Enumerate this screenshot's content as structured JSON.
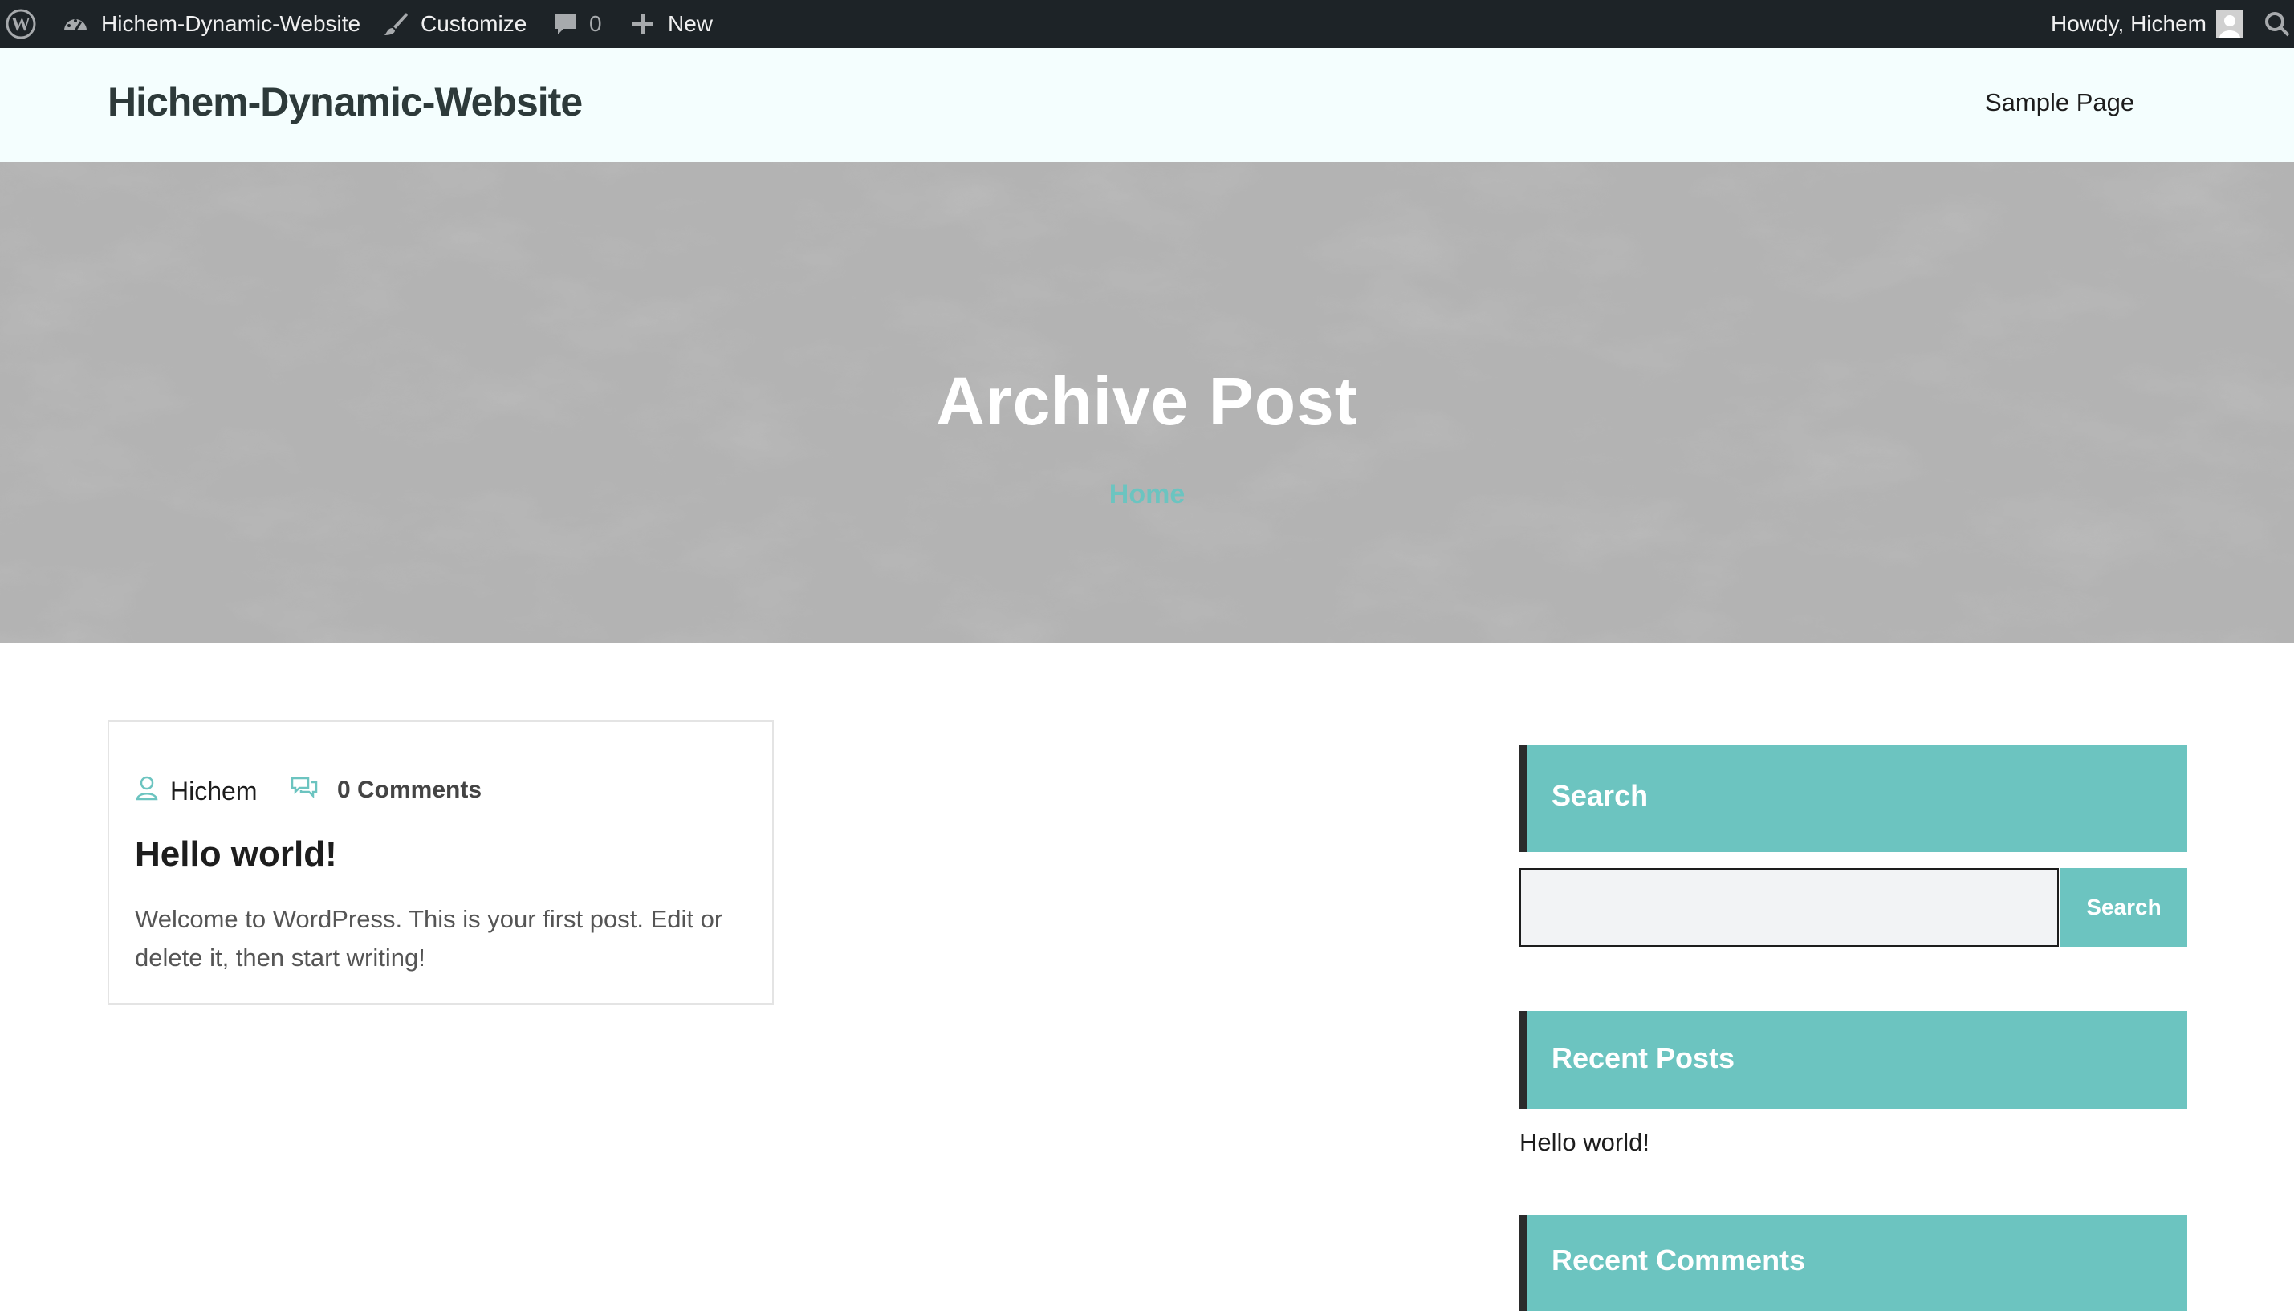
{
  "admin_bar": {
    "site_name": "Hichem-Dynamic-Website",
    "customize_label": "Customize",
    "comments_count": "0",
    "new_label": "New",
    "greeting": "Howdy, Hichem"
  },
  "header": {
    "site_title": "Hichem-Dynamic-Website",
    "nav": [
      "Sample Page"
    ]
  },
  "hero": {
    "title": "Archive Post",
    "breadcrumb": "Home"
  },
  "post": {
    "author": "Hichem",
    "comments": "0 Comments",
    "title": "Hello world!",
    "excerpt": "Welcome to WordPress. This is your first post. Edit or delete it, then start writing!"
  },
  "sidebar": {
    "search_title": "Search",
    "search_value": "",
    "search_button": "Search",
    "recent_posts_title": "Recent Posts",
    "recent_posts": [
      "Hello world!"
    ],
    "recent_comments_title": "Recent Comments"
  },
  "colors": {
    "admin_bar_bg": "#1d2327",
    "header_bg": "#f4fefe",
    "accent": "#6cc4c0",
    "widget_border": "#2b2b2b",
    "hero_bg": "#aeaeae"
  },
  "icons": [
    "wordpress-logo-icon",
    "dashboard-icon",
    "paintbrush-icon",
    "comment-bubble-icon",
    "plus-icon",
    "avatar",
    "search-icon",
    "user-icon",
    "comments-icon"
  ]
}
